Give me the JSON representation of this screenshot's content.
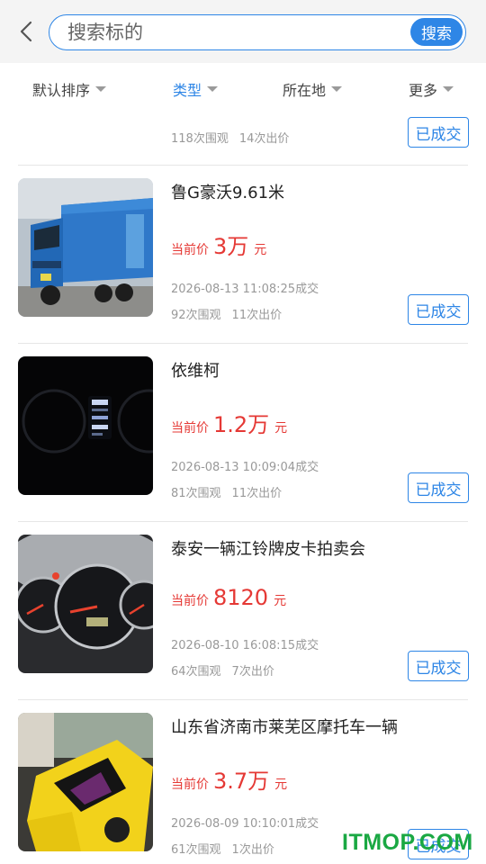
{
  "search": {
    "placeholder": "搜索标的",
    "button": "搜索"
  },
  "filters": [
    {
      "label": "默认排序",
      "active": false
    },
    {
      "label": "类型",
      "active": true
    },
    {
      "label": "所在地",
      "active": false
    },
    {
      "label": "更多",
      "active": false
    }
  ],
  "partial_item": {
    "views": "118次围观",
    "bids": "14次出价",
    "status": "已成交"
  },
  "items": [
    {
      "title": "鲁G豪沃9.61米",
      "price_label": "当前价",
      "price": "3万",
      "unit": "元",
      "deal_time": "2026-08-13 11:08:25成交",
      "views": "92次围观",
      "bids": "11次出价",
      "status": "已成交"
    },
    {
      "title": "依维柯",
      "price_label": "当前价",
      "price": "1.2万",
      "unit": "元",
      "deal_time": "2026-08-13 10:09:04成交",
      "views": "81次围观",
      "bids": "11次出价",
      "status": "已成交"
    },
    {
      "title": "泰安一辆江铃牌皮卡拍卖会",
      "price_label": "当前价",
      "price": "8120",
      "unit": "元",
      "deal_time": "2026-08-10 16:08:15成交",
      "views": "64次围观",
      "bids": "7次出价",
      "status": "已成交"
    },
    {
      "title": "山东省济南市莱芜区摩托车一辆",
      "price_label": "当前价",
      "price": "3.7万",
      "unit": "元",
      "deal_time": "2026-08-09 10:10:01成交",
      "views": "61次围观",
      "bids": "1次出价",
      "status": "已成交"
    }
  ],
  "watermark": "ITMOP.COM",
  "colors": {
    "accent": "#2e86e6",
    "price": "#e53935",
    "muted": "#999999"
  }
}
